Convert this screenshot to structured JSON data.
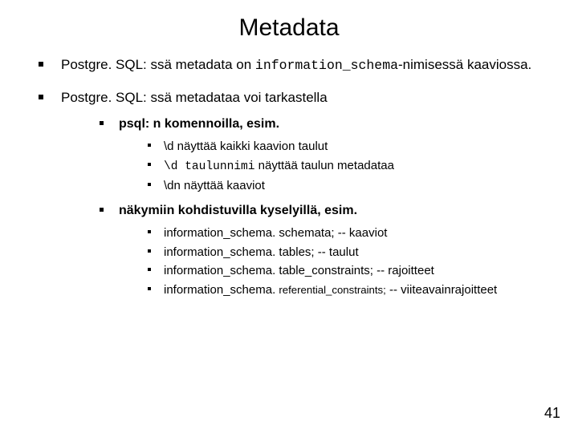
{
  "title": "Metadata",
  "bullets": {
    "b1_prefix": "Postgre. SQL: ssä metadata on ",
    "b1_code": "information_schema",
    "b1_suffix": "-nimisessä kaaviossa.",
    "b2": "Postgre. SQL: ssä metadataa voi tarkastella",
    "s1": "psql: n komennoilla, esim.",
    "s1a": "\\d näyttää kaikki kaavion taulut",
    "s1b_code": "\\d taulunnimi",
    "s1b_suffix": " näyttää taulun metadataa",
    "s1c": "\\dn näyttää kaaviot",
    "s2": "näkymiin kohdistuvilla kyselyillä, esim.",
    "s2a": "information_schema. schemata; -- kaaviot",
    "s2b": "information_schema. tables; -- taulut",
    "s2c": "information_schema. table_constraints; -- rajoitteet",
    "s2d_prefix": "information_schema. ",
    "s2d_small": "referential_constraints;",
    "s2d_suffix": " -- viiteavainrajoitteet"
  },
  "page_number": "41"
}
